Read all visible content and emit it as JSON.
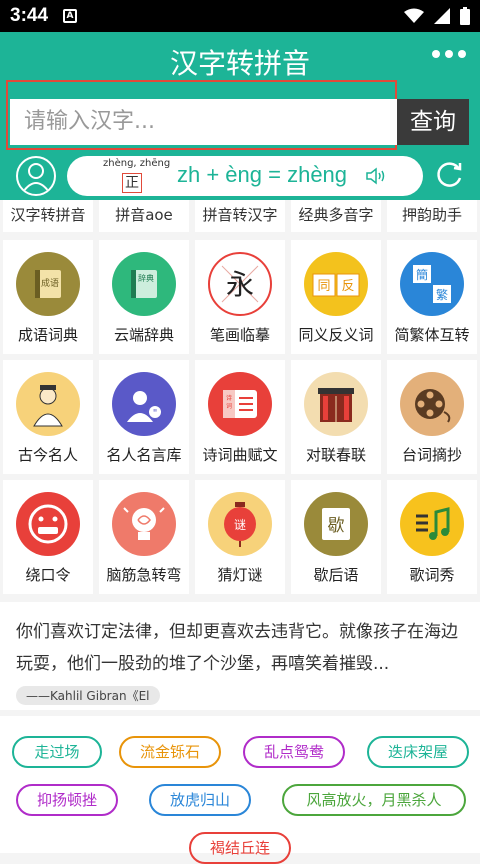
{
  "status": {
    "time": "3:44",
    "notif": "A"
  },
  "header": {
    "title": "汉字转拼音",
    "menu_icon": "more-icon"
  },
  "search": {
    "placeholder": "请输入汉字...",
    "button": "查询"
  },
  "pinyin": {
    "small": "zhèng, zhēng",
    "char": "正",
    "equation": "zh + èng = zhèng"
  },
  "tabs": [
    "汉字转拼音",
    "拼音aoe",
    "拼音转汉字",
    "经典多音字",
    "押韵助手"
  ],
  "grid": [
    [
      {
        "label": "成语词典",
        "icon": "idiom-book-icon",
        "color": "#9a8a3a"
      },
      {
        "label": "云端辞典",
        "icon": "cloud-dictionary-icon",
        "color": "#2eb87c"
      },
      {
        "label": "笔画临摹",
        "icon": "brush-stroke-icon",
        "color": "#ffffff"
      },
      {
        "label": "同义反义词",
        "icon": "synonym-icon",
        "color": "#f3c21d"
      },
      {
        "label": "简繁体互转",
        "icon": "simplified-traditional-icon",
        "color": "#2a86d8"
      }
    ],
    [
      {
        "label": "古今名人",
        "icon": "scholar-icon",
        "color": "#f7d27a"
      },
      {
        "label": "名人名言库",
        "icon": "quote-person-icon",
        "color": "#5a59c8"
      },
      {
        "label": "诗词曲赋文",
        "icon": "poetry-icon",
        "color": "#e8403a"
      },
      {
        "label": "对联春联",
        "icon": "couplet-door-icon",
        "color": "#f3ddb0"
      },
      {
        "label": "台词摘抄",
        "icon": "film-reel-icon",
        "color": "#e3b07a"
      }
    ],
    [
      {
        "label": "绕口令",
        "icon": "tongue-twister-icon",
        "color": "#e8403a"
      },
      {
        "label": "脑筋急转弯",
        "icon": "brain-bulb-icon",
        "color": "#ef7a6a"
      },
      {
        "label": "猜灯谜",
        "icon": "lantern-icon",
        "color": "#f7d27a"
      },
      {
        "label": "歇后语",
        "icon": "song-scroll-icon",
        "color": "#9a8a3a"
      },
      {
        "label": "歌词秀",
        "icon": "music-note-icon",
        "color": "#f7c21d"
      }
    ]
  ],
  "quote": {
    "text": "你们喜欢订定法律，但却更喜欢去违背它。就像孩子在海边玩耍，他们一股劲的堆了个沙堡，再嘻笑着摧毁...",
    "author": "——Kahlil Gibran《El"
  },
  "tags": [
    {
      "text": "走过场",
      "color": "#1db497"
    },
    {
      "text": "流金铄石",
      "color": "#e8940a"
    },
    {
      "text": "乱点鸳鸯",
      "color": "#b02cc9"
    },
    {
      "text": "迭床架屋",
      "color": "#1db497"
    },
    {
      "text": "抑扬顿挫",
      "color": "#b02cc9"
    },
    {
      "text": "放虎归山",
      "color": "#2a86d8"
    },
    {
      "text": "风高放火，月黑杀人",
      "color": "#4ca63c"
    },
    {
      "text": "褐结丘连",
      "color": "#e8403a"
    }
  ]
}
